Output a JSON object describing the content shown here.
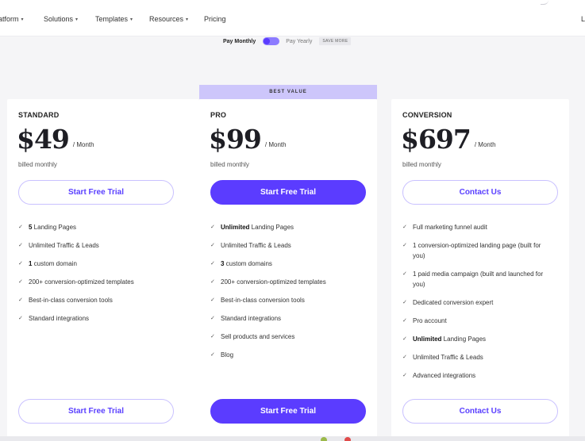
{
  "nav": {
    "items": [
      {
        "label": "atform",
        "caret": "▾"
      },
      {
        "label": "Solutions",
        "caret": "▾"
      },
      {
        "label": "Templates",
        "caret": "▾"
      },
      {
        "label": "Resources",
        "caret": "▾"
      },
      {
        "label": "Pricing",
        "caret": ""
      }
    ],
    "right_label": "L"
  },
  "toggle": {
    "monthly_label": "Pay Monthly",
    "yearly_label": "Pay Yearly",
    "save_badge": "SAVE MORE",
    "state": "monthly"
  },
  "best_value_label": "BEST VALUE",
  "plans": [
    {
      "name": "STANDARD",
      "price": "$49",
      "per": "/ Month",
      "billed": "billed monthly",
      "cta_top": "Start Free Trial",
      "cta_bottom": "Start Free Trial",
      "features": [
        {
          "bold": "5",
          "text": " Landing Pages"
        },
        {
          "bold": "",
          "text": "Unlimited Traffic & Leads"
        },
        {
          "bold": "1",
          "text": " custom domain"
        },
        {
          "bold": "",
          "text": "200+ conversion-optimized templates"
        },
        {
          "bold": "",
          "text": "Best-in-class conversion tools"
        },
        {
          "bold": "",
          "text": "Standard integrations"
        }
      ]
    },
    {
      "name": "PRO",
      "price": "$99",
      "per": "/ Month",
      "billed": "billed monthly",
      "cta_top": "Start Free Trial",
      "cta_bottom": "Start Free Trial",
      "features": [
        {
          "bold": "Unlimited",
          "text": " Landing Pages"
        },
        {
          "bold": "",
          "text": "Unlimited Traffic & Leads"
        },
        {
          "bold": "3",
          "text": " custom domains"
        },
        {
          "bold": "",
          "text": "200+ conversion-optimized templates"
        },
        {
          "bold": "",
          "text": "Best-in-class conversion tools"
        },
        {
          "bold": "",
          "text": "Standard integrations"
        },
        {
          "bold": "",
          "text": "Sell products and services"
        },
        {
          "bold": "",
          "text": "Blog"
        }
      ]
    },
    {
      "name": "CONVERSION",
      "price": "$697",
      "per": "/ Month",
      "billed": "billed monthly",
      "cta_top": "Contact Us",
      "cta_bottom": "Contact Us",
      "features": [
        {
          "bold": "",
          "text": "Full marketing funnel audit"
        },
        {
          "bold": "",
          "text": "1 conversion-optimized landing page (built for you)"
        },
        {
          "bold": "",
          "text": "1 paid media campaign (built and launched for you)"
        },
        {
          "bold": "",
          "text": "Dedicated conversion expert"
        },
        {
          "bold": "",
          "text": "Pro account"
        },
        {
          "bold": "Unlimited",
          "text": " Landing Pages"
        },
        {
          "bold": "",
          "text": "Unlimited Traffic & Leads"
        },
        {
          "bold": "",
          "text": "Advanced integrations"
        }
      ]
    }
  ],
  "icons": {
    "check": "check-icon",
    "caret": "chevron-down-icon"
  },
  "colors": {
    "accent": "#5b3cff",
    "accent_light": "#c9c1ff",
    "banner": "#cdc6fb"
  }
}
